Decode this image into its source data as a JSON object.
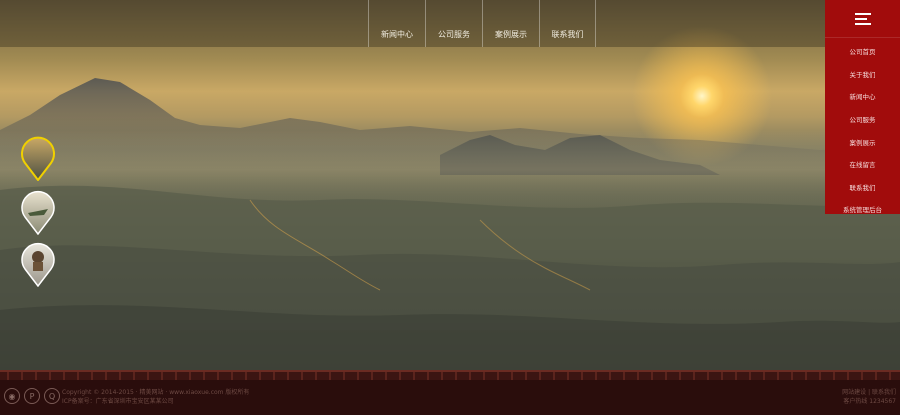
{
  "nav": {
    "items": [
      {
        "label": "新闻中心"
      },
      {
        "label": "公司服务"
      },
      {
        "label": "案例展示"
      },
      {
        "label": "联系我们"
      }
    ]
  },
  "side_menu": {
    "items": [
      {
        "label": "公司首页"
      },
      {
        "label": "关于我们"
      },
      {
        "label": "新闻中心"
      },
      {
        "label": "公司服务"
      },
      {
        "label": "案例展示"
      },
      {
        "label": "在线留言"
      },
      {
        "label": "联系我们"
      },
      {
        "label": "系统管理后台"
      }
    ]
  },
  "footer": {
    "copyright": "Copyright © 2014-2015 · 精美网站 · www.xiaoxue.com 版权所有",
    "icp": "ICP备案号：广东省深圳市宝安区某某公司",
    "right_line1": "网站建设 | 联系我们",
    "right_line2": "客户热线 1234567"
  },
  "colors": {
    "menu_red": "#a10c0c",
    "footer_bg": "#2a0d0c",
    "thumb_active": "#f0d000"
  },
  "icons": {
    "menu": "hamburger-icon",
    "footer": [
      "weibo-icon",
      "pinterest-icon",
      "qq-icon"
    ]
  }
}
